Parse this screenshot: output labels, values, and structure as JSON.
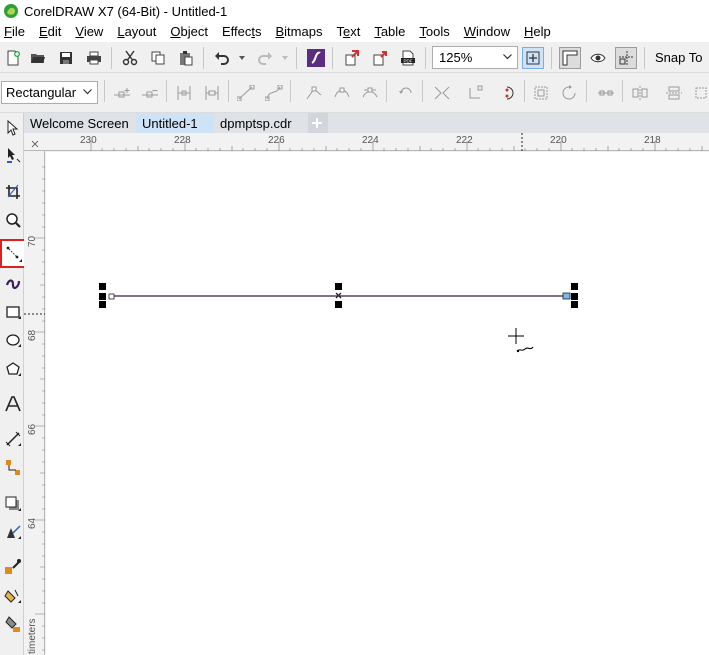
{
  "window": {
    "title": "CorelDRAW X7 (64-Bit) - Untitled-1"
  },
  "menu": {
    "items": [
      "File",
      "Edit",
      "View",
      "Layout",
      "Object",
      "Effects",
      "Bitmaps",
      "Text",
      "Table",
      "Tools",
      "Window",
      "Help"
    ]
  },
  "toolbar": {
    "zoom_value": "125%",
    "snap_to_label": "Snap To",
    "buttons": [
      "new-document-icon",
      "open-folder-icon",
      "save-icon",
      "print-icon",
      "cut-icon",
      "copy-icon",
      "paste-icon",
      "undo-icon",
      "redo-icon",
      "search-content-icon",
      "import-icon",
      "export-icon",
      "publish-pdf-icon",
      "zoom-fit-icon",
      "ruler-icon",
      "view-icon",
      "guidelines-icon"
    ]
  },
  "property_bar": {
    "mode_value": "Rectangular",
    "buttons": [
      "add-node-icon",
      "delete-node-icon",
      "join-nodes-icon",
      "break-curve-icon",
      "to-line-icon",
      "to-curve-icon",
      "cusp-node-icon",
      "smooth-node-icon",
      "symmetrical-node-icon",
      "reverse-direction-icon",
      "extract-subpath-icon",
      "extend-curve-icon",
      "close-curve-icon",
      "stretch-nodes-icon",
      "rotate-nodes-icon",
      "align-nodes-icon",
      "reflect-nodes-icon",
      "select-all-nodes-icon"
    ]
  },
  "tabs": [
    {
      "label": "Welcome Screen",
      "active": false
    },
    {
      "label": "Untitled-1",
      "active": true
    },
    {
      "label": "dpmptsp.cdr",
      "active": false
    }
  ],
  "ruler": {
    "top_labels": [
      "230",
      "228",
      "226",
      "224",
      "222",
      "220",
      "218"
    ],
    "left_labels": [
      "70",
      "68",
      "66",
      "64"
    ],
    "units": "timeters"
  },
  "colors": {
    "line": "#3a1f3a",
    "highlight": "#e02020",
    "active_tab": "#cfe3f7"
  }
}
